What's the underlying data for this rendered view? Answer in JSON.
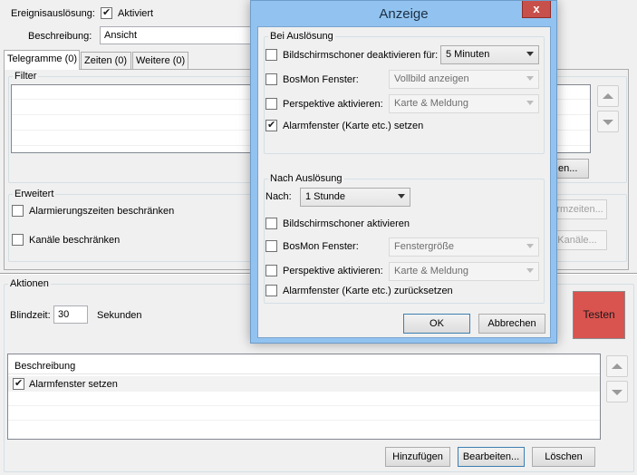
{
  "top": {
    "trigger_label": "Ereignisauslösung:",
    "active_label": "Aktiviert",
    "active_checked": true,
    "description_label": "Beschreibung:",
    "description_value": "Ansicht"
  },
  "tabs": [
    {
      "label": "Telegramme (0)",
      "active": true
    },
    {
      "label": "Zeiten (0)",
      "active": false
    },
    {
      "label": "Weitere (0)",
      "active": false
    }
  ],
  "filter": {
    "title": "Filter",
    "partial_button": "en..."
  },
  "erweitert": {
    "title": "Erweitert",
    "limit_times_label": "Alarmierungszeiten beschränken",
    "limit_channels_label": "Kanäle beschränken",
    "alarmzeiten_button": "armzeiten...",
    "kanaele_button": "Kanäle..."
  },
  "aktionen": {
    "title": "Aktionen",
    "blindzeit_label": "Blindzeit:",
    "blindzeit_value": "30",
    "seconds_label": "Sekunden",
    "test_button": "Testen",
    "test_color": "#d9534f",
    "list_header": "Beschreibung",
    "items": [
      {
        "label": "Alarmfenster setzen",
        "checked": true
      }
    ],
    "add_button": "Hinzufügen",
    "edit_button": "Bearbeiten...",
    "delete_button": "Löschen"
  },
  "dialog": {
    "title": "Anzeige",
    "close_glyph": "x",
    "bei": {
      "title": "Bei Auslösung",
      "screensaver_label": "Bildschirmschoner deaktivieren für:",
      "screensaver_value": "5 Minuten",
      "bosmon_label": "BosMon Fenster:",
      "bosmon_value": "Vollbild anzeigen",
      "perspective_label": "Perspektive aktivieren:",
      "perspective_value": "Karte & Meldung",
      "alarm_label": "Alarmfenster (Karte etc.) setzen",
      "alarm_checked": true
    },
    "nach": {
      "title": "Nach Auslösung",
      "nach_label": "Nach:",
      "nach_value": "1 Stunde",
      "screensaver_label": "Bildschirmschoner aktivieren",
      "bosmon_label": "BosMon Fenster:",
      "bosmon_value": "Fenstergröße",
      "perspective_label": "Perspektive aktivieren:",
      "perspective_value": "Karte & Meldung",
      "alarm_label": "Alarmfenster (Karte etc.) zurücksetzen"
    },
    "ok_button": "OK",
    "cancel_button": "Abbrechen"
  }
}
